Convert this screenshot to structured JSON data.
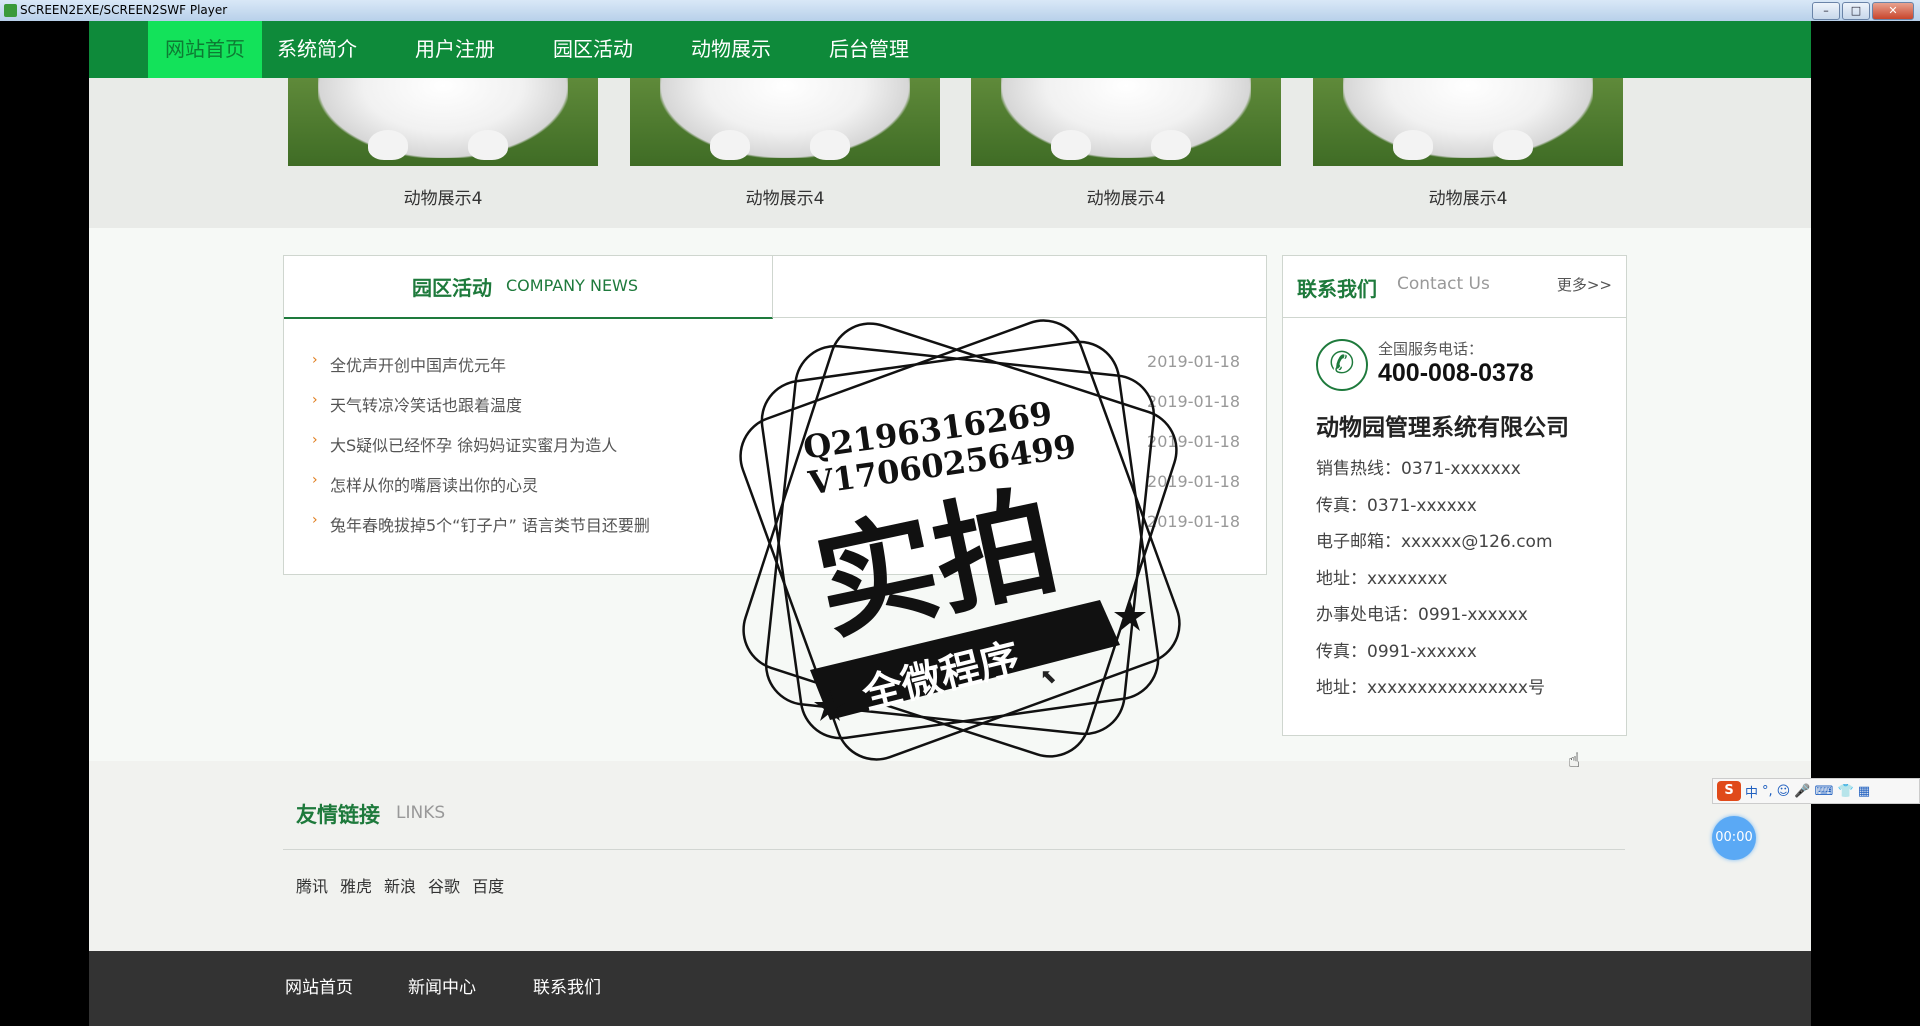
{
  "window": {
    "title": "SCREEN2EXE/SCREEN2SWF Player",
    "min": "–",
    "max": "□",
    "close": "✕"
  },
  "nav": {
    "items": [
      "网站首页",
      "系统简介",
      "用户注册",
      "园区活动",
      "动物展示",
      "后台管理"
    ],
    "active_index": 0
  },
  "gallery": {
    "captions": [
      "动物展示4",
      "动物展示4",
      "动物展示4",
      "动物展示4"
    ]
  },
  "news": {
    "title_cn": "园区活动",
    "title_en": "COMPANY NEWS",
    "items": [
      {
        "title": "全优声开创中国声优元年",
        "date": "2019-01-18"
      },
      {
        "title": "天气转凉冷笑话也跟着温度",
        "date": "2019-01-18"
      },
      {
        "title": "大S疑似已经怀孕 徐妈妈证实蜜月为造人",
        "date": "2019-01-18"
      },
      {
        "title": "怎样从你的嘴唇读出你的心灵",
        "date": "2019-01-18"
      },
      {
        "title": "兔年春晚拔掉5个“钉子户” 语言类节目还要删",
        "date": "2019-01-18"
      }
    ]
  },
  "contact": {
    "title_cn": "联系我们",
    "title_en": "Contact Us",
    "more": "更多>>",
    "phone_label": "全国服务电话：",
    "phone": "400-008-0378",
    "company": "动物园管理系统有限公司",
    "lines": [
      "销售热线：0371-xxxxxxx",
      "传真：0371-xxxxxx",
      "电子邮箱：xxxxxx@126.com",
      "地址：xxxxxxxx",
      "办事处电话：0991-xxxxxx",
      "传真：0991-xxxxxx",
      "地址：xxxxxxxxxxxxxxxx号"
    ]
  },
  "stamp": {
    "qq": "Q2196316269",
    "vx": "V17060256499",
    "big": "实拍",
    "banner": "全微程序"
  },
  "links": {
    "title_cn": "友情链接",
    "title_en": "LINKS",
    "items": [
      "腾讯",
      "雅虎",
      "新浪",
      "谷歌",
      "百度"
    ]
  },
  "footer": {
    "items": [
      "网站首页",
      "新闻中心",
      "联系我们"
    ]
  },
  "ime": {
    "logo": "S",
    "mode": "中",
    "punct": "°,",
    "icons": "☺ 🎤 ⌨ 👕 ▦"
  },
  "timer": {
    "label": "00:00"
  },
  "colors": {
    "nav_bg": "#0e8a3a",
    "nav_active": "#13e25a",
    "accent": "#1e7a3c",
    "footer_bg": "#333333",
    "arrow": "#e07b1a"
  }
}
